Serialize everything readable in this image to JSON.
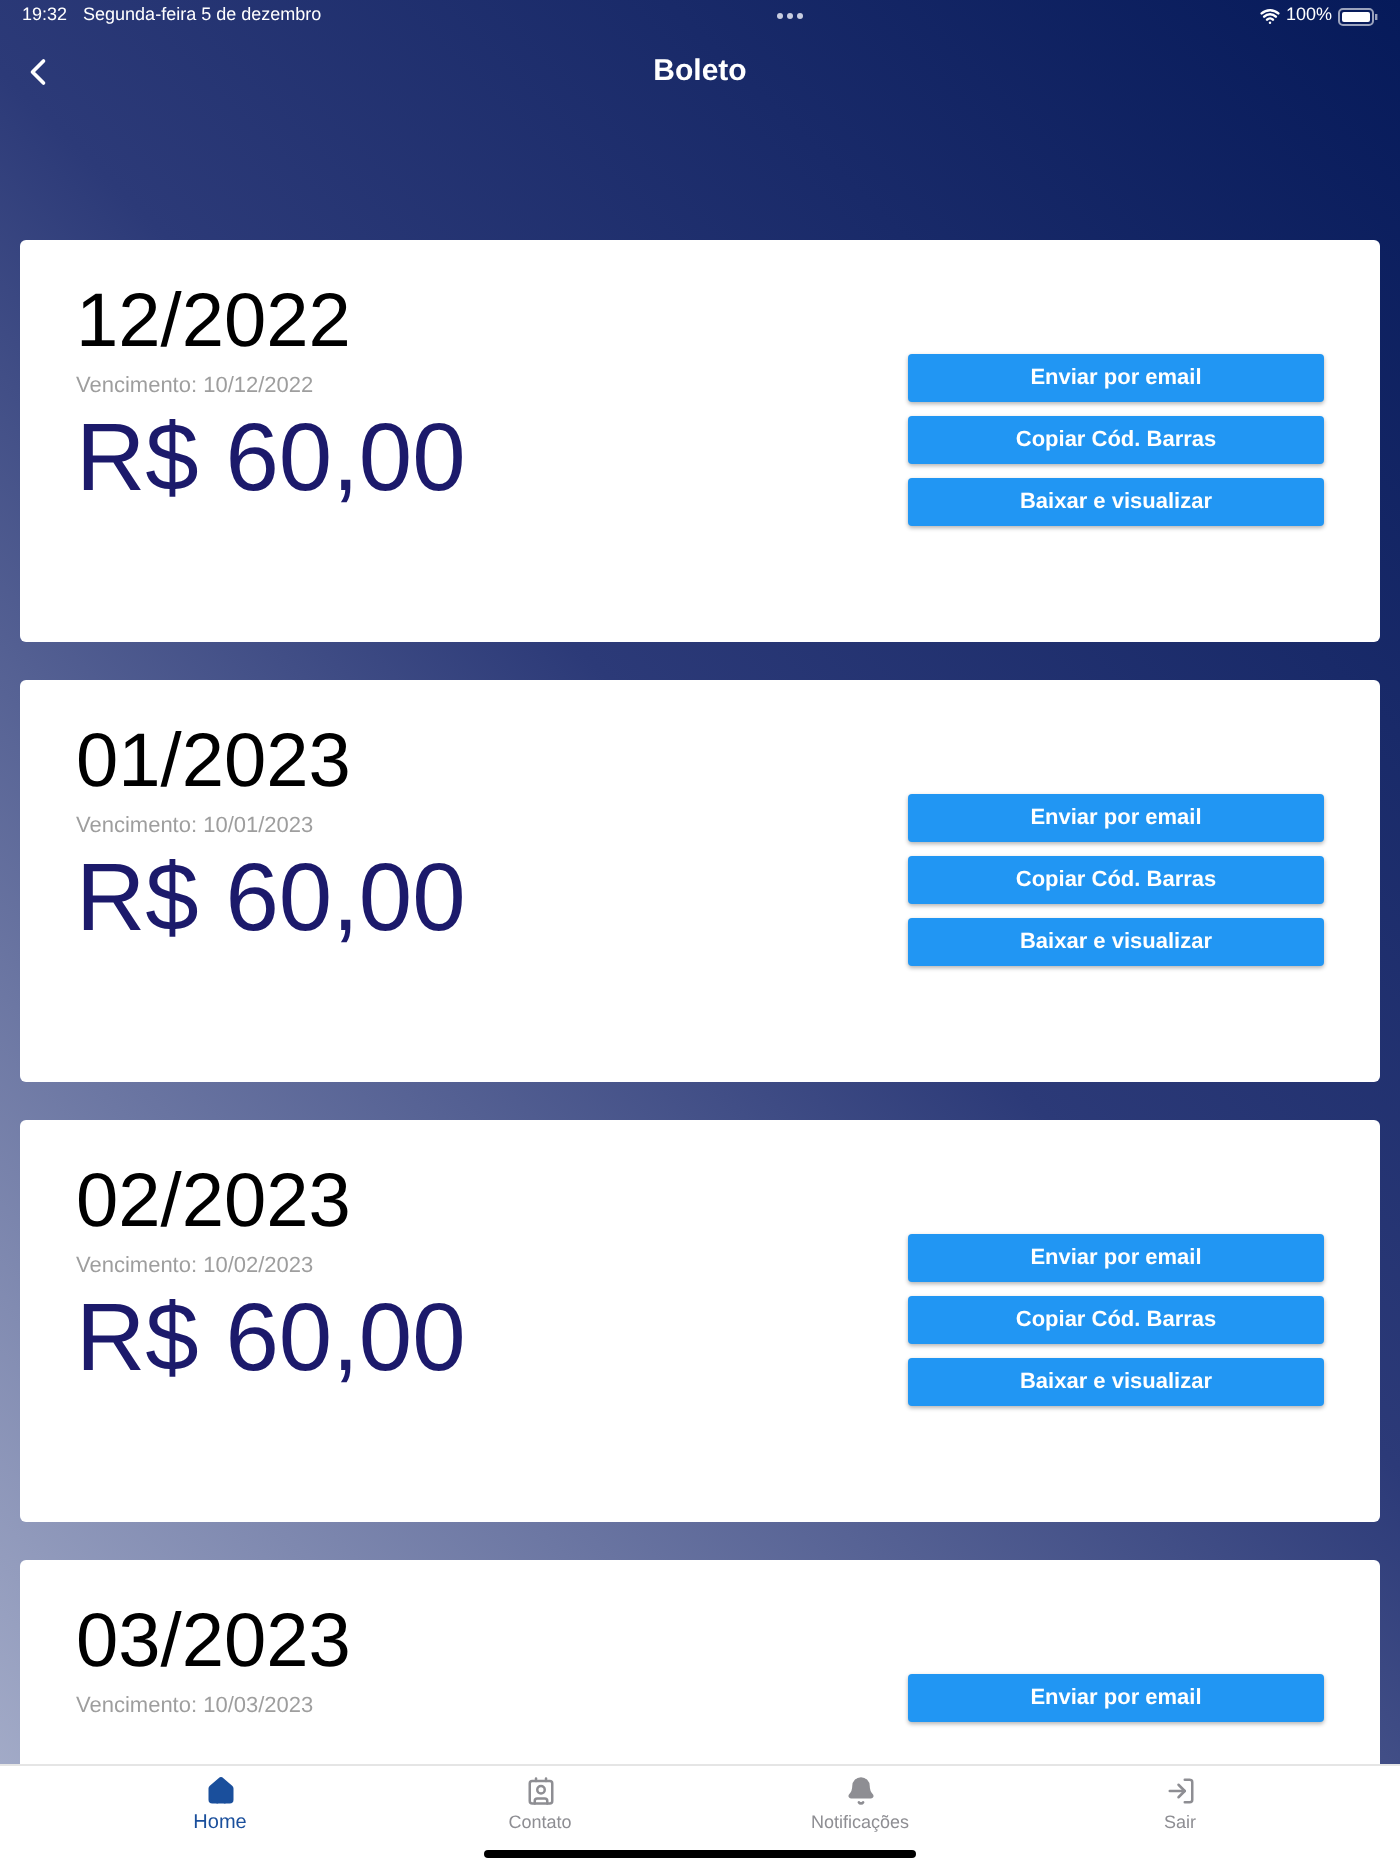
{
  "status_bar": {
    "time": "19:32",
    "date": "Segunda-feira 5 de dezembro",
    "battery": "100%"
  },
  "header": {
    "title": "Boleto"
  },
  "boletos": [
    {
      "period": "12/2022",
      "due": "Vencimento: 10/12/2022",
      "amount": "R$ 60,00",
      "buttons": [
        "Enviar por email",
        "Copiar Cód. Barras",
        "Baixar e visualizar"
      ]
    },
    {
      "period": "01/2023",
      "due": "Vencimento: 10/01/2023",
      "amount": "R$ 60,00",
      "buttons": [
        "Enviar por email",
        "Copiar Cód. Barras",
        "Baixar e visualizar"
      ]
    },
    {
      "period": "02/2023",
      "due": "Vencimento: 10/02/2023",
      "amount": "R$ 60,00",
      "buttons": [
        "Enviar por email",
        "Copiar Cód. Barras",
        "Baixar e visualizar"
      ]
    },
    {
      "period": "03/2023",
      "due": "Vencimento: 10/03/2023",
      "buttons": [
        "Enviar por email"
      ]
    }
  ],
  "tab_bar": [
    {
      "kind": "home",
      "label": "Home",
      "selected": true
    },
    {
      "kind": "contact",
      "label": "Contato",
      "selected": false
    },
    {
      "kind": "bell",
      "label": "Notificações",
      "selected": false
    },
    {
      "kind": "exit",
      "label": "Sair",
      "selected": false
    }
  ]
}
